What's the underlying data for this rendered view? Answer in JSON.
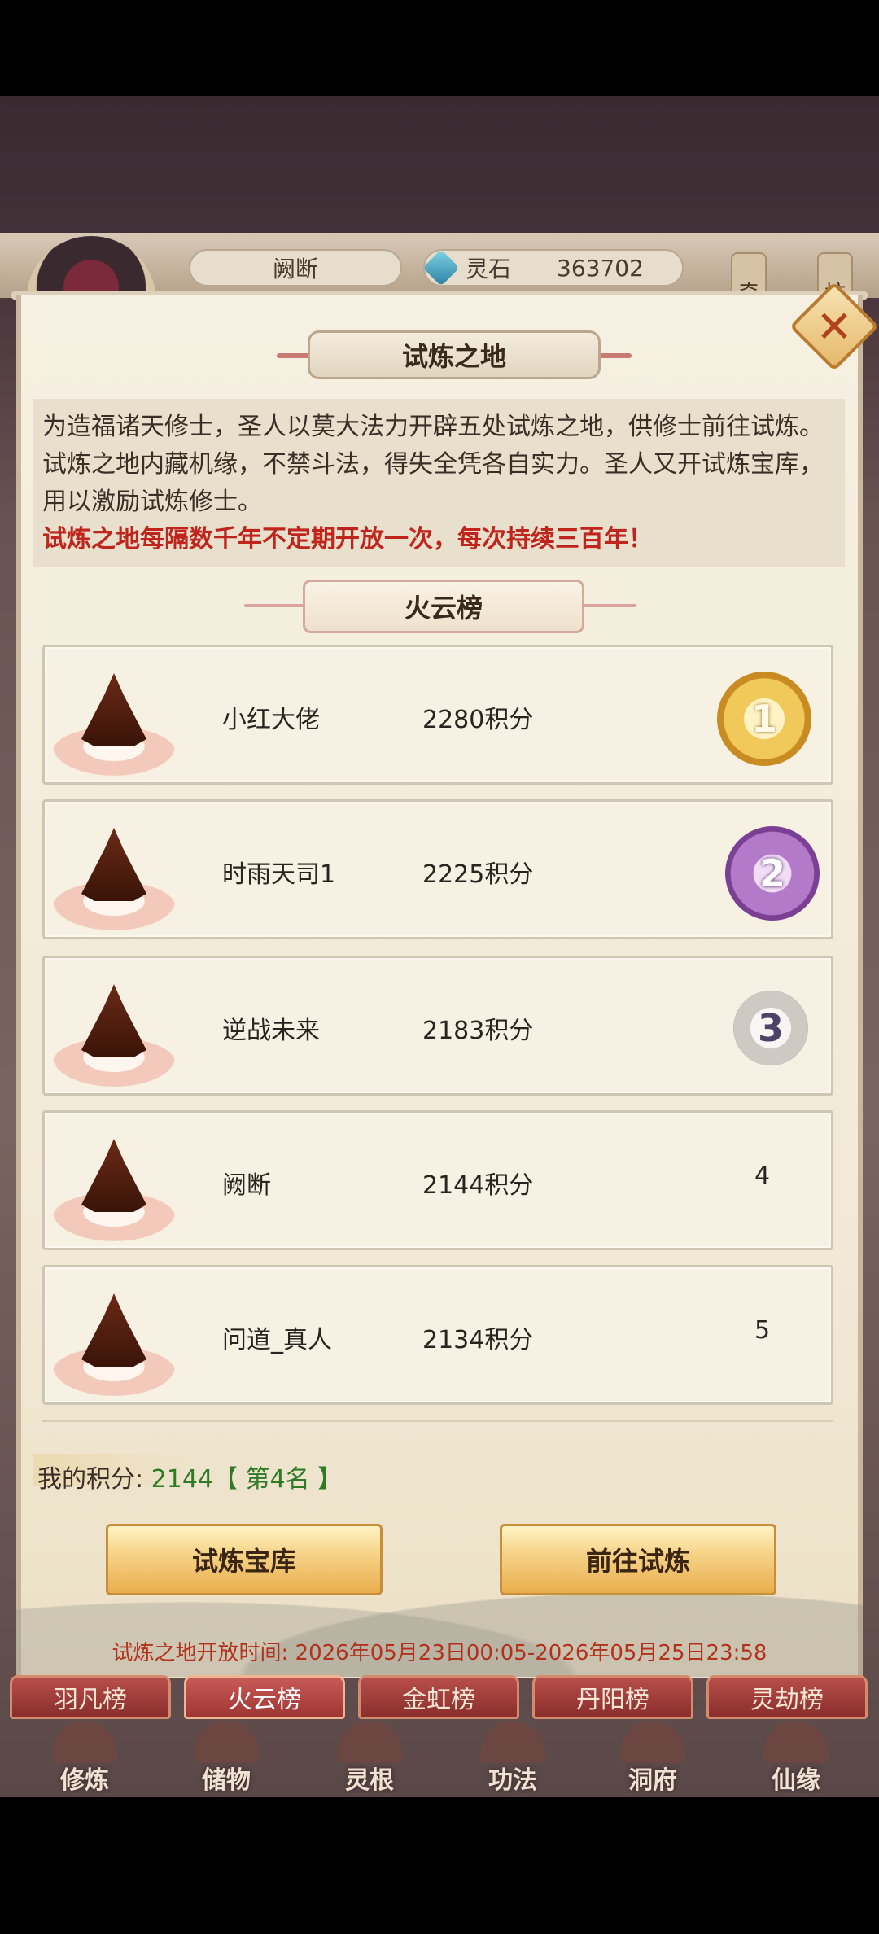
{
  "header": {
    "player_name": "阙断",
    "currency_label": "灵石",
    "currency_value": "363702",
    "side_tab_left": "奇",
    "side_tab_right": "坊"
  },
  "panel": {
    "title": "试炼之地",
    "description": "为造福诸天修士，圣人以莫大法力开辟五处试炼之地，供修士前往试炼。试炼之地内藏机缘，不禁斗法，得失全凭各自实力。圣人又开试炼宝库，用以激励试炼修士。",
    "warning": "试炼之地每隔数千年不定期开放一次，每次持续三百年！",
    "ranking_title": "火云榜"
  },
  "ranking": [
    {
      "name": "小红大佬",
      "score": "2280积分",
      "rank": "1"
    },
    {
      "name": "时雨天司1",
      "score": "2225积分",
      "rank": "2"
    },
    {
      "name": "逆战未来",
      "score": "2183积分",
      "rank": "3"
    },
    {
      "name": "阙断",
      "score": "2144积分",
      "rank": "4"
    },
    {
      "name": "问道_真人",
      "score": "2134积分",
      "rank": "5"
    }
  ],
  "my_score": {
    "label": "我的积分:",
    "value": "2144【 第4名 】"
  },
  "buttons": {
    "treasury": "试炼宝库",
    "go_trial": "前往试炼"
  },
  "open_time": "试炼之地开放时间: 2026年05月23日00:05-2026年05月25日23:58",
  "tabs": [
    {
      "label": "羽凡榜",
      "active": false
    },
    {
      "label": "火云榜",
      "active": true
    },
    {
      "label": "金虹榜",
      "active": false
    },
    {
      "label": "丹阳榜",
      "active": false
    },
    {
      "label": "灵劫榜",
      "active": false
    }
  ],
  "nav": [
    {
      "label": "修炼",
      "icon": "cultivate-icon"
    },
    {
      "label": "储物",
      "icon": "storage-icon"
    },
    {
      "label": "灵根",
      "icon": "spirit-root-icon"
    },
    {
      "label": "功法",
      "icon": "technique-icon"
    },
    {
      "label": "洞府",
      "icon": "cave-icon"
    },
    {
      "label": "仙缘",
      "icon": "fate-icon"
    }
  ]
}
